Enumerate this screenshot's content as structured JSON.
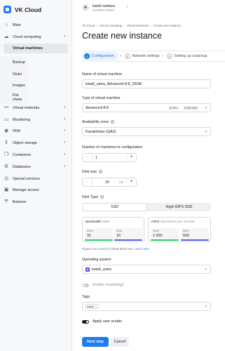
{
  "app": {
    "title": "VK Cloud"
  },
  "user": {
    "name": "kata6-saidaev",
    "id": "mcs8697134522"
  },
  "sidebar": {
    "items": [
      {
        "label": "Main",
        "icon": "house-icon"
      },
      {
        "label": "Cloud computing",
        "icon": "cloud-icon"
      },
      {
        "label": "Virtual machines"
      },
      {
        "label": "Backup"
      },
      {
        "label": "Disks"
      },
      {
        "label": "Images"
      },
      {
        "label": "File share"
      },
      {
        "label": "Virtual networks",
        "icon": "network-icon"
      },
      {
        "label": "Monitoring",
        "icon": "monitoring-icon"
      },
      {
        "label": "DNS",
        "icon": "dns-icon"
      },
      {
        "label": "Object storage",
        "icon": "storage-icon"
      },
      {
        "label": "Containers",
        "icon": "containers-icon"
      },
      {
        "label": "Databases",
        "icon": "databases-icon"
      },
      {
        "label": "Special services",
        "icon": "special-services-icon"
      },
      {
        "label": "Manage access",
        "icon": "access-icon"
      },
      {
        "label": "Balance",
        "icon": "balance-icon"
      }
    ]
  },
  "breadcrumbs": [
    "VK Cloud",
    "Cloud computing",
    "Virtual machines",
    "Create new instance"
  ],
  "page_title": "Create new instance",
  "steps": [
    {
      "num": "1",
      "label": "Configuration"
    },
    {
      "num": "2",
      "label": "Network settings"
    },
    {
      "num": "3",
      "label": "Setting up a backup"
    }
  ],
  "form": {
    "vm_name": {
      "label": "Name of virtual machine",
      "value": "kata6_astra_Advanced-8-8_20GB"
    },
    "vm_type": {
      "label": "Type of virtual machine",
      "value": "Advanced-8-8",
      "cpu": "8 CPU",
      "ram": "8 GB RAM"
    },
    "zone": {
      "label": "Availability zone",
      "value": "Kazakhstan (QAZ)"
    },
    "machines": {
      "label": "Number of machines in configuration",
      "value": "1"
    },
    "disk_size": {
      "label": "Disk size",
      "value": "20",
      "unit": "GB"
    },
    "disk_type": {
      "label": "Disk Type",
      "options": [
        "SSD",
        "High-IOPS SSD"
      ],
      "selected": "SSD"
    },
    "bandwidth": {
      "title": "Bandwidth",
      "unit": "MB/s",
      "read_label": "Read",
      "read": "31",
      "write_label": "Write",
      "write": "16"
    },
    "iops": {
      "title": "IOPS",
      "unit": "Operations per second",
      "read_label": "Read",
      "read": "1 000",
      "write_label": "Write",
      "write": "500"
    },
    "note": "Figures are correct for 64KB block size.",
    "note_link": "Learn more",
    "os": {
      "label": "Operating system",
      "value": "kata6_astra"
    },
    "monitoring": {
      "label": "Enable monitoring"
    },
    "tags": {
      "label": "Tags",
      "items": [
        "kata6"
      ]
    },
    "user_scripts": {
      "label": "Apply user scripts"
    }
  },
  "buttons": {
    "next": "Next step",
    "cancel": "Cancel"
  },
  "colors": {
    "accent": "#1f7cf0",
    "bandwidth_read": "#2ecc71",
    "bandwidth_write": "#5b5fe0"
  }
}
